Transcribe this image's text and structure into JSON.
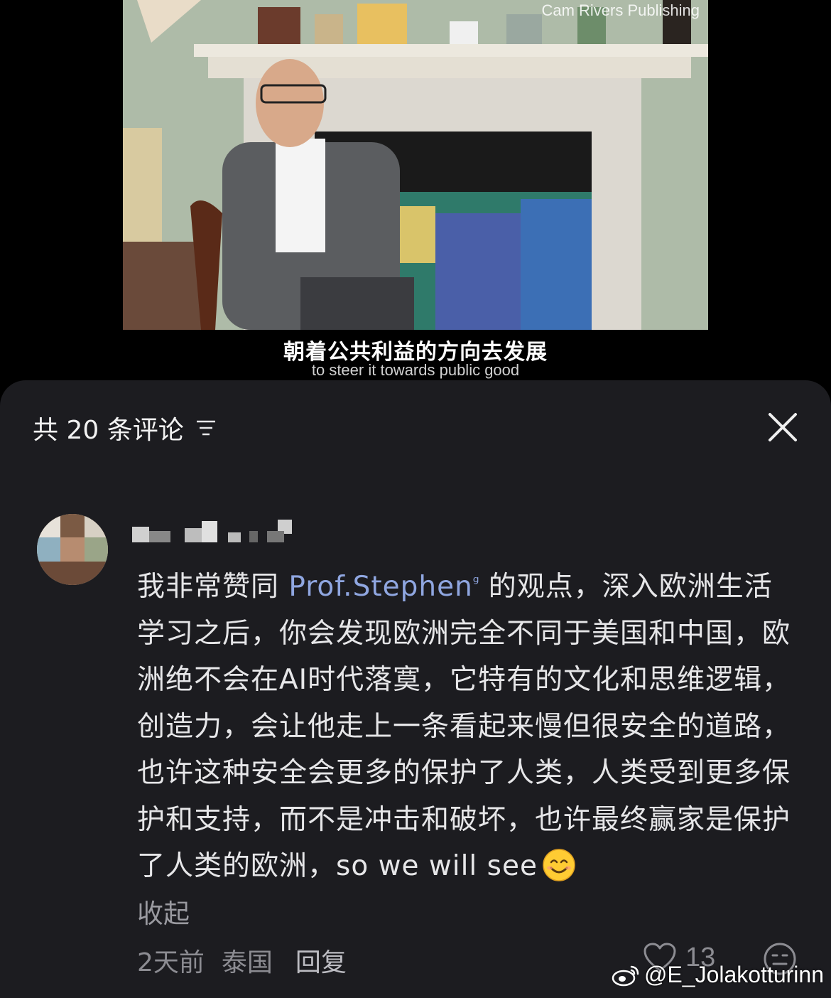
{
  "video": {
    "watermark": "Cam Rivers Publishing",
    "subtitle_cn": "朝着公共利益的方向去发展",
    "subtitle_en": "to steer it towards public good"
  },
  "comments_panel": {
    "header_title": "共 20 条评论",
    "comment": {
      "text_before": "我非常赞同 ",
      "mention": "Prof.Stephen",
      "mention_icon": "ᵍ",
      "text_after": "的观点，深入欧洲生活学习之后，你会发现欧洲完全不同于美国和中国，欧洲绝不会在AI时代落寞，它特有的文化和思维逻辑，创造力，会让他走上一条看起来慢但很安全的道路，也许这种安全会更多的保护了人类，人类受到更多保护和支持，而不是冲击和破坏，也许最终赢家是保护了人类的欧洲，so we will see",
      "emoji": "smiling-face-icon",
      "collapse_label": "收起",
      "time": "2天前",
      "location": "泰国",
      "reply_label": "回复",
      "like_count": "13"
    }
  },
  "weibo_watermark": "@E_Jolakotturinn"
}
